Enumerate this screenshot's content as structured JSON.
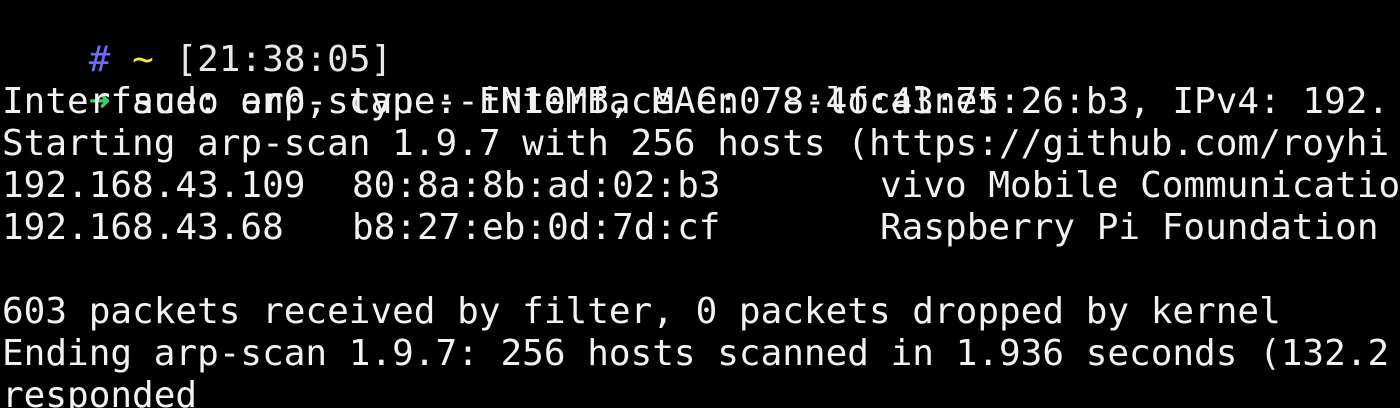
{
  "prompt": {
    "hash": "#",
    "tilde": "~",
    "time": "[21:38:05]",
    "arrow": "➜",
    "command": "sudo arp-scan --interface en0 --localnet"
  },
  "output": {
    "interface_line": "Interface: en0, type: EN10MB, MAC: 78:4f:43:75:26:b3, IPv4: 192.",
    "starting_line": "Starting arp-scan 1.9.7 with 256 hosts (https://github.com/royhi",
    "hosts": [
      {
        "ip": "192.168.43.109",
        "mac": "80:8a:8b:ad:02:b3",
        "vendor": "vivo Mobile Communicatio"
      },
      {
        "ip": "192.168.43.68",
        "mac": "b8:27:eb:0d:7d:cf",
        "vendor": "Raspberry Pi Foundation"
      }
    ],
    "packets_line": "603 packets received by filter, 0 packets dropped by kernel",
    "ending_line": "Ending arp-scan 1.9.7: 256 hosts scanned in 1.936 seconds (132.2",
    "responded_line": "responded"
  },
  "colors": {
    "background": "#000000",
    "foreground": "#f2f2f2",
    "hash": "#6b6bff",
    "tilde": "#f2e63a",
    "arrow": "#3ad06b"
  }
}
